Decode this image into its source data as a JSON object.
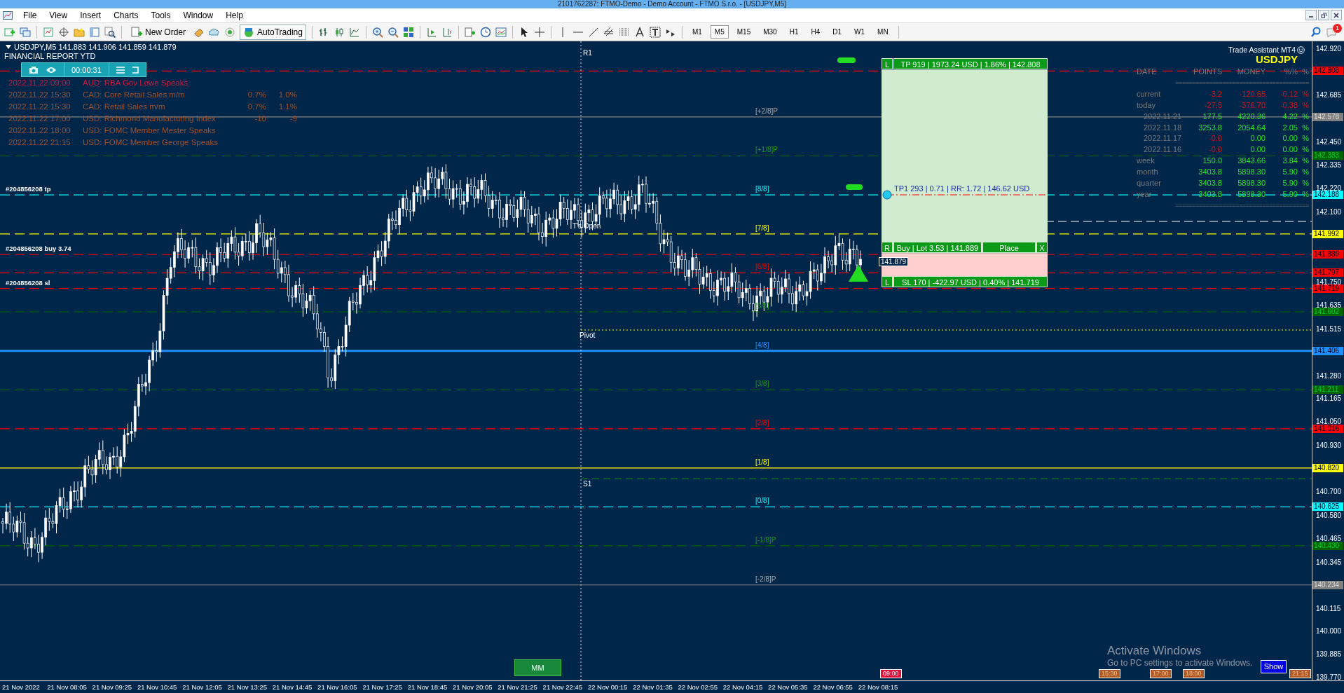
{
  "window": {
    "title": "2101762287: FTMO-Demo - Demo Account - FTMO S.r.o. - [USDJPY,M5]"
  },
  "menu": [
    "File",
    "View",
    "Insert",
    "Charts",
    "Tools",
    "Window",
    "Help"
  ],
  "toolbar": {
    "new_order": "New Order",
    "auto_trading": "AutoTrading",
    "timeframes": [
      {
        "label": "M1",
        "selected": false
      },
      {
        "label": "M5",
        "selected": true
      },
      {
        "label": "M15",
        "selected": false
      },
      {
        "label": "M30",
        "selected": false
      },
      {
        "label": "H1",
        "selected": false
      },
      {
        "label": "H4",
        "selected": false
      },
      {
        "label": "D1",
        "selected": false
      },
      {
        "label": "W1",
        "selected": false
      },
      {
        "label": "MN",
        "selected": false
      }
    ],
    "notifications": "1"
  },
  "chart": {
    "symbol": "USDJPY,M5",
    "prices": "141.883 141.906 141.859 141.879",
    "report_title": "FINANCIAL REPORT YTD",
    "timer": "00:00:31",
    "news": [
      {
        "time": "2022.11.22 09:00",
        "event": "AUD: RBA Gov Lowe Speaks",
        "color": "#dc143c"
      },
      {
        "time": "2022.11.22 15:30",
        "event": "CAD: Core Retail Sales m/m",
        "forecast": "0.7%",
        "previous": "1.0%",
        "color": "#a0522d"
      },
      {
        "time": "2022.11.22 15:30",
        "event": "CAD: Retail Sales m/m",
        "forecast": "0.7%",
        "previous": "1.1%",
        "color": "#a0522d"
      },
      {
        "time": "2022.11.22 17:00",
        "event": "USD: Richmond Manufacturing Index",
        "forecast": "-10",
        "previous": "-9",
        "color": "#a0522d"
      },
      {
        "time": "2022.11.22 18:00",
        "event": "USD: FOMC Member Mester Speaks",
        "color": "#a0522d"
      },
      {
        "time": "2022.11.22 21:15",
        "event": "USD: FOMC Member George Speaks",
        "color": "#a0522d"
      }
    ],
    "lines": [
      {
        "price": "142.808",
        "color": "#ff0000",
        "kind": "dashed"
      },
      {
        "price": "142.578",
        "color": "#808080",
        "kind": "solid",
        "label": "[+2/8]P"
      },
      {
        "price": "142.383",
        "color": "#006400",
        "kind": "dashed",
        "label": "[+1/8]P"
      },
      {
        "price": "142.188",
        "color": "#00ffff",
        "kind": "dashed",
        "label": "[8/8]",
        "order_label": "#204856208 tp"
      },
      {
        "price": "141.992",
        "color": "#ffff00",
        "kind": "dashed",
        "label": "[7/8]"
      },
      {
        "price": "141.889",
        "color": "#ff0000",
        "kind": "dashed",
        "order_label": "#204856208 buy 3.74"
      },
      {
        "price": "141.797",
        "color": "#ff0000",
        "kind": "dashed",
        "label": "[6/8]"
      },
      {
        "price": "141.719",
        "color": "#ff0000",
        "kind": "dashed",
        "order_label": "#204856208 sl"
      },
      {
        "price": "141.602",
        "color": "#006400",
        "kind": "dashed",
        "label": "[5/8]"
      },
      {
        "price": "141.406",
        "color": "#1e90ff",
        "kind": "solid",
        "label": "[4/8]"
      },
      {
        "price": "141.211",
        "color": "#006400",
        "kind": "dashed",
        "label": "[3/8]"
      },
      {
        "price": "141.016",
        "color": "#ff0000",
        "kind": "dashed",
        "label": "[2/8]"
      },
      {
        "price": "140.820",
        "color": "#ffff00",
        "kind": "solid",
        "label": "[1/8]"
      },
      {
        "price": "140.625",
        "color": "#00ffff",
        "kind": "dashed",
        "label": "[0/8]"
      },
      {
        "price": "140.430",
        "color": "#006400",
        "kind": "dashed",
        "label": "[-1/8]P"
      },
      {
        "price": "140.234",
        "color": "#808080",
        "kind": "solid",
        "label": "[-2/8]P"
      }
    ],
    "pivots": [
      "R1",
      "T's Open",
      "Pivot",
      "S1"
    ],
    "current_price": "141.879",
    "price_axis": [
      "142.920",
      "142.685",
      "142.450",
      "142.335",
      "142.220",
      "142.100",
      "141.750",
      "141.635",
      "141.515",
      "141.280",
      "141.165",
      "141.050",
      "140.930",
      "140.700",
      "140.580",
      "140.465",
      "140.345",
      "140.115",
      "140.000",
      "139.885",
      "139.770"
    ],
    "trade_panel": {
      "tp_side": "L",
      "tp_text": "TP 919 | 1973.24 USD | 1.86% | 142.808",
      "tp1_text": "TP1 293 | 0.71 | RR: 1.72 | 146.62 USD",
      "entry_side": "R",
      "entry_text": "Buy | Lot 3.53 | 141.889",
      "place": "Place",
      "close": "X",
      "sl_side": "L",
      "sl_text": "SL 170 | -422.97 USD | 0.40% | 141.719"
    },
    "stats": {
      "title": "Trade Assistant MT4",
      "symbol": "USDJPY",
      "columns": [
        "DATE",
        "POINTS",
        "MONEY",
        "%%",
        "%"
      ],
      "separator": "========================================",
      "rows": [
        {
          "date": "current",
          "points": "-3.2",
          "money": "-120.65",
          "percent": "-0.12",
          "unit": "%",
          "loss_points": true,
          "loss_money": true
        },
        {
          "date": "today",
          "points": "-27.5",
          "money": "-376.70",
          "percent": "-0.38",
          "unit": "%",
          "loss_points": true,
          "loss_money": true
        },
        {
          "date": "2022.11.21",
          "points": "177.5",
          "money": "4220.36",
          "percent": "4.22",
          "unit": "%",
          "loss_points": false,
          "loss_money": false
        },
        {
          "date": "2022.11.18",
          "points": "3253.8",
          "money": "2054.64",
          "percent": "2.05",
          "unit": "%",
          "loss_points": false,
          "loss_money": false
        },
        {
          "date": "2022.11.17",
          "points": "-0.0",
          "money": "0.00",
          "percent": "0.00",
          "unit": "%",
          "loss_points": true,
          "loss_money": false
        },
        {
          "date": "2022.11.16",
          "points": "-0.0",
          "money": "0.00",
          "percent": "0.00",
          "unit": "%",
          "loss_points": true,
          "loss_money": false
        },
        {
          "date": "week",
          "points": "150.0",
          "money": "3843.66",
          "percent": "3.84",
          "unit": "%",
          "loss_points": false,
          "loss_money": false
        },
        {
          "date": "month",
          "points": "3403.8",
          "money": "5898.30",
          "percent": "5.90",
          "unit": "%",
          "loss_points": false,
          "loss_money": false
        },
        {
          "date": "quarter",
          "points": "3403.8",
          "money": "5898.30",
          "percent": "5.90",
          "unit": "%",
          "loss_points": false,
          "loss_money": false
        },
        {
          "date": "year",
          "points": "3403.8",
          "money": "5898.30",
          "percent": "5.90",
          "unit": "%",
          "loss_points": false,
          "loss_money": false
        }
      ]
    },
    "mm_button": "MM",
    "show_button": "Show",
    "events": [
      {
        "time": "09:00",
        "color": "#e0103a"
      },
      {
        "time": "15:30",
        "color": "#b05a2a"
      },
      {
        "time": "17:00",
        "color": "#b05a2a"
      },
      {
        "time": "18:00",
        "color": "#b05a2a"
      },
      {
        "time": "21:15",
        "color": "#b05a2a"
      }
    ],
    "time_axis": [
      "21 Nov 2022",
      "21 Nov 08:05",
      "21 Nov 09:25",
      "21 Nov 10:45",
      "21 Nov 12:05",
      "21 Nov 13:25",
      "21 Nov 14:45",
      "21 Nov 16:05",
      "21 Nov 17:25",
      "21 Nov 18:45",
      "21 Nov 20:05",
      "21 Nov 21:25",
      "21 Nov 22:45",
      "22 Nov 00:15",
      "22 Nov 01:35",
      "22 Nov 02:55",
      "22 Nov 04:15",
      "22 Nov 05:35",
      "22 Nov 06:55",
      "22 Nov 08:15"
    ]
  },
  "activation": {
    "title": "Activate Windows",
    "subtitle": "Go to PC settings to activate Windows."
  }
}
